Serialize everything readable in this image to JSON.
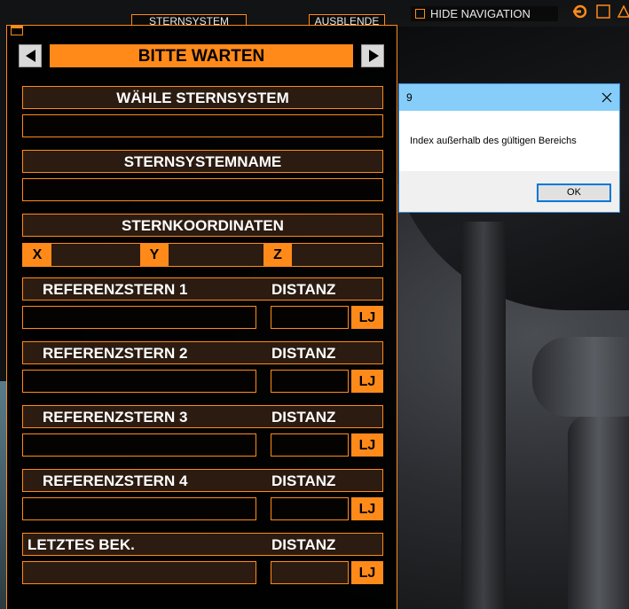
{
  "tabs": {
    "sternsystem": "STERNSYSTEM",
    "ausblende": "AUSBLENDE"
  },
  "nav": {
    "status": "BITTE WARTEN"
  },
  "sections": {
    "select_system": "WÄHLE STERNSYSTEM",
    "system_name": "STERNSYSTEMNAME",
    "coordinates": "STERNKOORDINATEN"
  },
  "coords": {
    "x_label": "X",
    "y_label": "Y",
    "z_label": "Z"
  },
  "references": [
    {
      "name": "REFERENZSTERN 1",
      "distance_label": "DISTANZ",
      "unit": "LJ"
    },
    {
      "name": "REFERENZSTERN 2",
      "distance_label": "DISTANZ",
      "unit": "LJ"
    },
    {
      "name": "REFERENZSTERN 3",
      "distance_label": "DISTANZ",
      "unit": "LJ"
    },
    {
      "name": "REFERENZSTERN 4",
      "distance_label": "DISTANZ",
      "unit": "LJ"
    },
    {
      "name": "LETZTES BEK.",
      "distance_label": "DISTANZ",
      "unit": "LJ"
    }
  ],
  "top_nav": {
    "hide_navigation": "HIDE NAVIGATION"
  },
  "dialog": {
    "title": "9",
    "message": "Index außerhalb des gültigen Bereichs",
    "ok_label": "OK"
  },
  "colors": {
    "accent": "#ff8a1a",
    "panel_bg": "#000000",
    "header_bg": "#2b1b10",
    "dialog_title_bg": "#87cdf9"
  },
  "icons": [
    "window-icon",
    "arrow-left-icon",
    "arrow-right-icon",
    "checkbox-icon",
    "refresh-icon",
    "square-icon",
    "warning-triangle-icon",
    "close-icon"
  ]
}
